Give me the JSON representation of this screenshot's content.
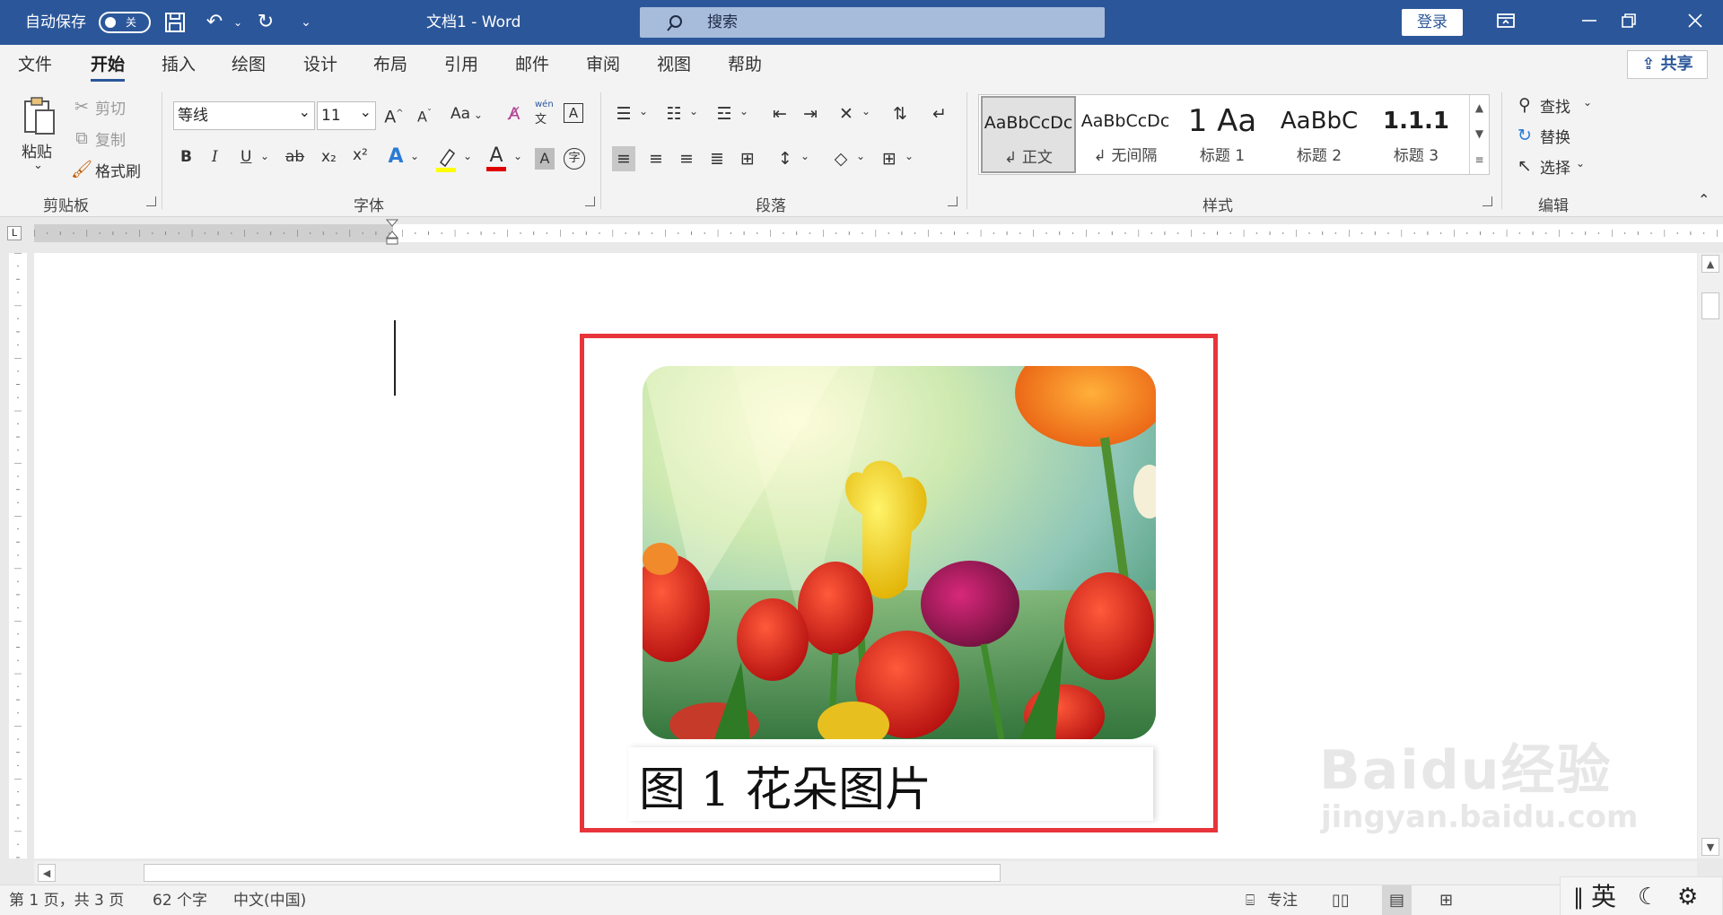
{
  "title_bar": {
    "autosave_label": "自动保存",
    "autosave_state": "关",
    "doc_title": "文档1 - Word",
    "search_placeholder": "搜索",
    "signin_label": "登录"
  },
  "tabs": [
    "文件",
    "开始",
    "插入",
    "绘图",
    "设计",
    "布局",
    "引用",
    "邮件",
    "审阅",
    "视图",
    "帮助"
  ],
  "active_tab": "开始",
  "share_label": "共享",
  "clipboard": {
    "paste": "粘贴",
    "cut": "剪切",
    "copy": "复制",
    "format_painter": "格式刷",
    "group": "剪贴板"
  },
  "font": {
    "name": "等线",
    "size": "11",
    "case": "Aa",
    "bold": "B",
    "italic": "I",
    "underline": "U",
    "strike": "ab",
    "sub": "x₂",
    "sup": "x²",
    "phonetic_top": "wén",
    "phonetic_bottom": "文",
    "group": "字体"
  },
  "paragraph": {
    "group": "段落"
  },
  "styles": {
    "items": [
      {
        "preview": "AaBbCcDc",
        "name": "↲ 正文"
      },
      {
        "preview": "AaBbCcDc",
        "name": "↲ 无间隔"
      },
      {
        "preview": "1  Aa",
        "name": "标题 1"
      },
      {
        "preview": "AaBbC",
        "name": "标题 2"
      },
      {
        "preview": "1.1.1",
        "name": "标题 3"
      }
    ],
    "group": "样式"
  },
  "editing": {
    "find": "查找",
    "replace": "替换",
    "select": "选择",
    "group": "编辑"
  },
  "document": {
    "caption": "图 1 花朵图片"
  },
  "status_bar": {
    "page": "第 1 页，共 3 页",
    "words": "62 个字",
    "language": "中文(中国)",
    "focus": "专注",
    "ime": "英"
  },
  "watermark": {
    "main": "Baidu经验",
    "url": "jingyan.baidu.com"
  },
  "colors": {
    "title_bar": "#2b579a",
    "highlight_box": "#e8343b",
    "highlight_yellow": "#ffff00",
    "font_red": "#e00000"
  }
}
